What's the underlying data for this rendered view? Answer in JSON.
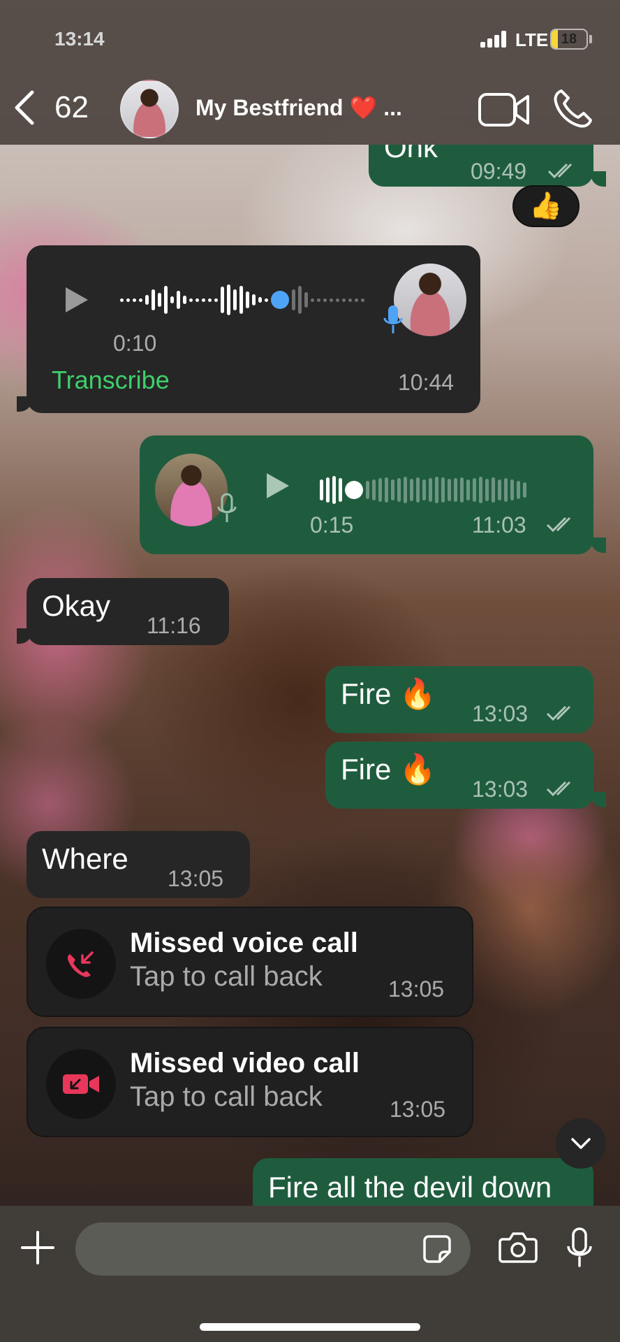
{
  "status_bar": {
    "time": "13:14",
    "network": "LTE",
    "battery": "18",
    "battery_level": 0.18
  },
  "header": {
    "back_count": "62",
    "contact_name": "My Bestfriend ❤️ ...",
    "icons": {
      "back": "chevron-left-icon",
      "video": "video-camera-icon",
      "call": "phone-icon"
    }
  },
  "messages": [
    {
      "type": "text",
      "direction": "out",
      "text": "Ohk",
      "time": "09:49",
      "read": true,
      "reaction": "👍"
    },
    {
      "type": "voice",
      "direction": "in",
      "duration": "0:10",
      "time": "10:44",
      "action_label": "Transcribe",
      "progress": 0.67
    },
    {
      "type": "voice",
      "direction": "out",
      "duration": "0:15",
      "time": "11:03",
      "read": true,
      "progress": 0.12
    },
    {
      "type": "text",
      "direction": "in",
      "text": "Okay",
      "time": "11:16"
    },
    {
      "type": "text",
      "direction": "out",
      "text": "Fire 🔥",
      "time": "13:03",
      "read": true
    },
    {
      "type": "text",
      "direction": "out",
      "text": "Fire 🔥",
      "time": "13:03",
      "read": true
    },
    {
      "type": "text",
      "direction": "in",
      "text": "Where",
      "time": "13:05"
    },
    {
      "type": "missed_call",
      "direction": "in",
      "title": "Missed voice call",
      "subtitle": "Tap to call back",
      "time": "13:05",
      "icon": "missed-voice-call-icon"
    },
    {
      "type": "missed_call",
      "direction": "in",
      "title": "Missed video call",
      "subtitle": "Tap to call back",
      "time": "13:05",
      "icon": "missed-video-call-icon"
    },
    {
      "type": "text",
      "direction": "out",
      "text": "Fire all the devil down"
    }
  ],
  "composer": {
    "input_value": "",
    "placeholder": "",
    "icons": {
      "plus": "plus-icon",
      "sticker": "sticker-icon",
      "camera": "camera-icon",
      "mic": "microphone-icon"
    }
  },
  "colors": {
    "outgoing_bubble": "#1f5c3e",
    "incoming_bubble": "#262626",
    "transcribe": "#3fcf6b",
    "missed_call": "#e8375a",
    "voice_progress_dot": "#4fa3f7"
  }
}
